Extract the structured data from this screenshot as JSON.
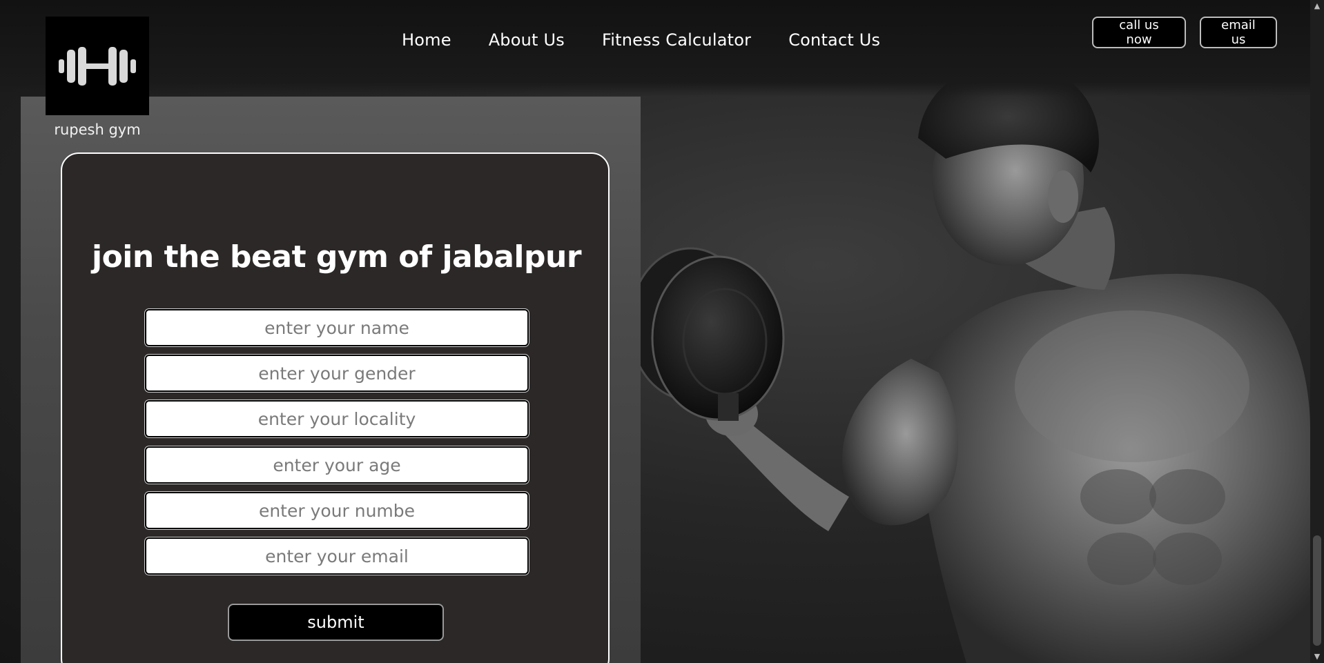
{
  "brand": {
    "name": "rupesh gym",
    "logo_icon": "dumbbell-icon"
  },
  "nav": {
    "items": [
      {
        "label": "Home"
      },
      {
        "label": "About Us"
      },
      {
        "label": "Fitness Calculator"
      },
      {
        "label": "Contact Us"
      }
    ]
  },
  "header_buttons": {
    "call_label": "call us now",
    "email_label": "email us"
  },
  "form": {
    "title": "join the beat gym of jabalpur",
    "fields": [
      {
        "placeholder": "enter your name",
        "value": ""
      },
      {
        "placeholder": "enter your gender",
        "value": ""
      },
      {
        "placeholder": "enter your locality",
        "value": ""
      },
      {
        "placeholder": "enter your age",
        "value": ""
      },
      {
        "placeholder": "enter your numbe",
        "value": ""
      },
      {
        "placeholder": "enter your email",
        "value": ""
      }
    ],
    "submit_label": "submit"
  },
  "colors": {
    "card_background": "#2c2828",
    "button_background": "#000000",
    "text": "#ffffff"
  }
}
